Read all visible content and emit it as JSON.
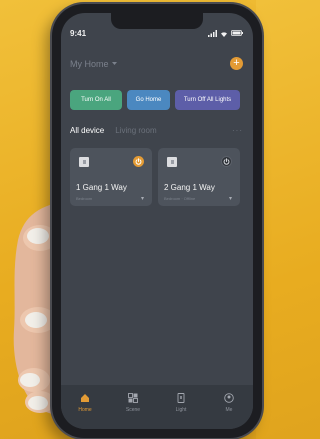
{
  "status_bar": {
    "time": "9:41"
  },
  "header": {
    "home_name": "My Home",
    "add_label": "+"
  },
  "scenes": [
    {
      "label": "Turn On All",
      "color": "#4aa57e"
    },
    {
      "label": "Go Home",
      "color": "#4b88c0"
    },
    {
      "label": "Turn Off All Lights",
      "color": "#5d5ea8"
    }
  ],
  "room_tabs": [
    {
      "label": "All device",
      "active": true
    },
    {
      "label": "Living room",
      "active": false
    }
  ],
  "room_tabs_more": "···",
  "devices": [
    {
      "name": "1 Gang 1 Way",
      "status": "Bedroom",
      "power": "on",
      "more": "▾"
    },
    {
      "name": "2 Gang 1 Way",
      "status": "Bedroom · Offline",
      "power": "off",
      "more": "▾"
    }
  ],
  "tab_bar": [
    {
      "label": "Home",
      "icon": "home-icon",
      "active": true
    },
    {
      "label": "Scene",
      "icon": "scene-icon",
      "active": false
    },
    {
      "label": "Light",
      "icon": "light-icon",
      "active": false
    },
    {
      "label": "Me",
      "icon": "me-icon",
      "active": false
    }
  ],
  "colors": {
    "accent": "#e39b35",
    "screen_bg": "#3f444c",
    "card_bg": "#4d535c"
  }
}
